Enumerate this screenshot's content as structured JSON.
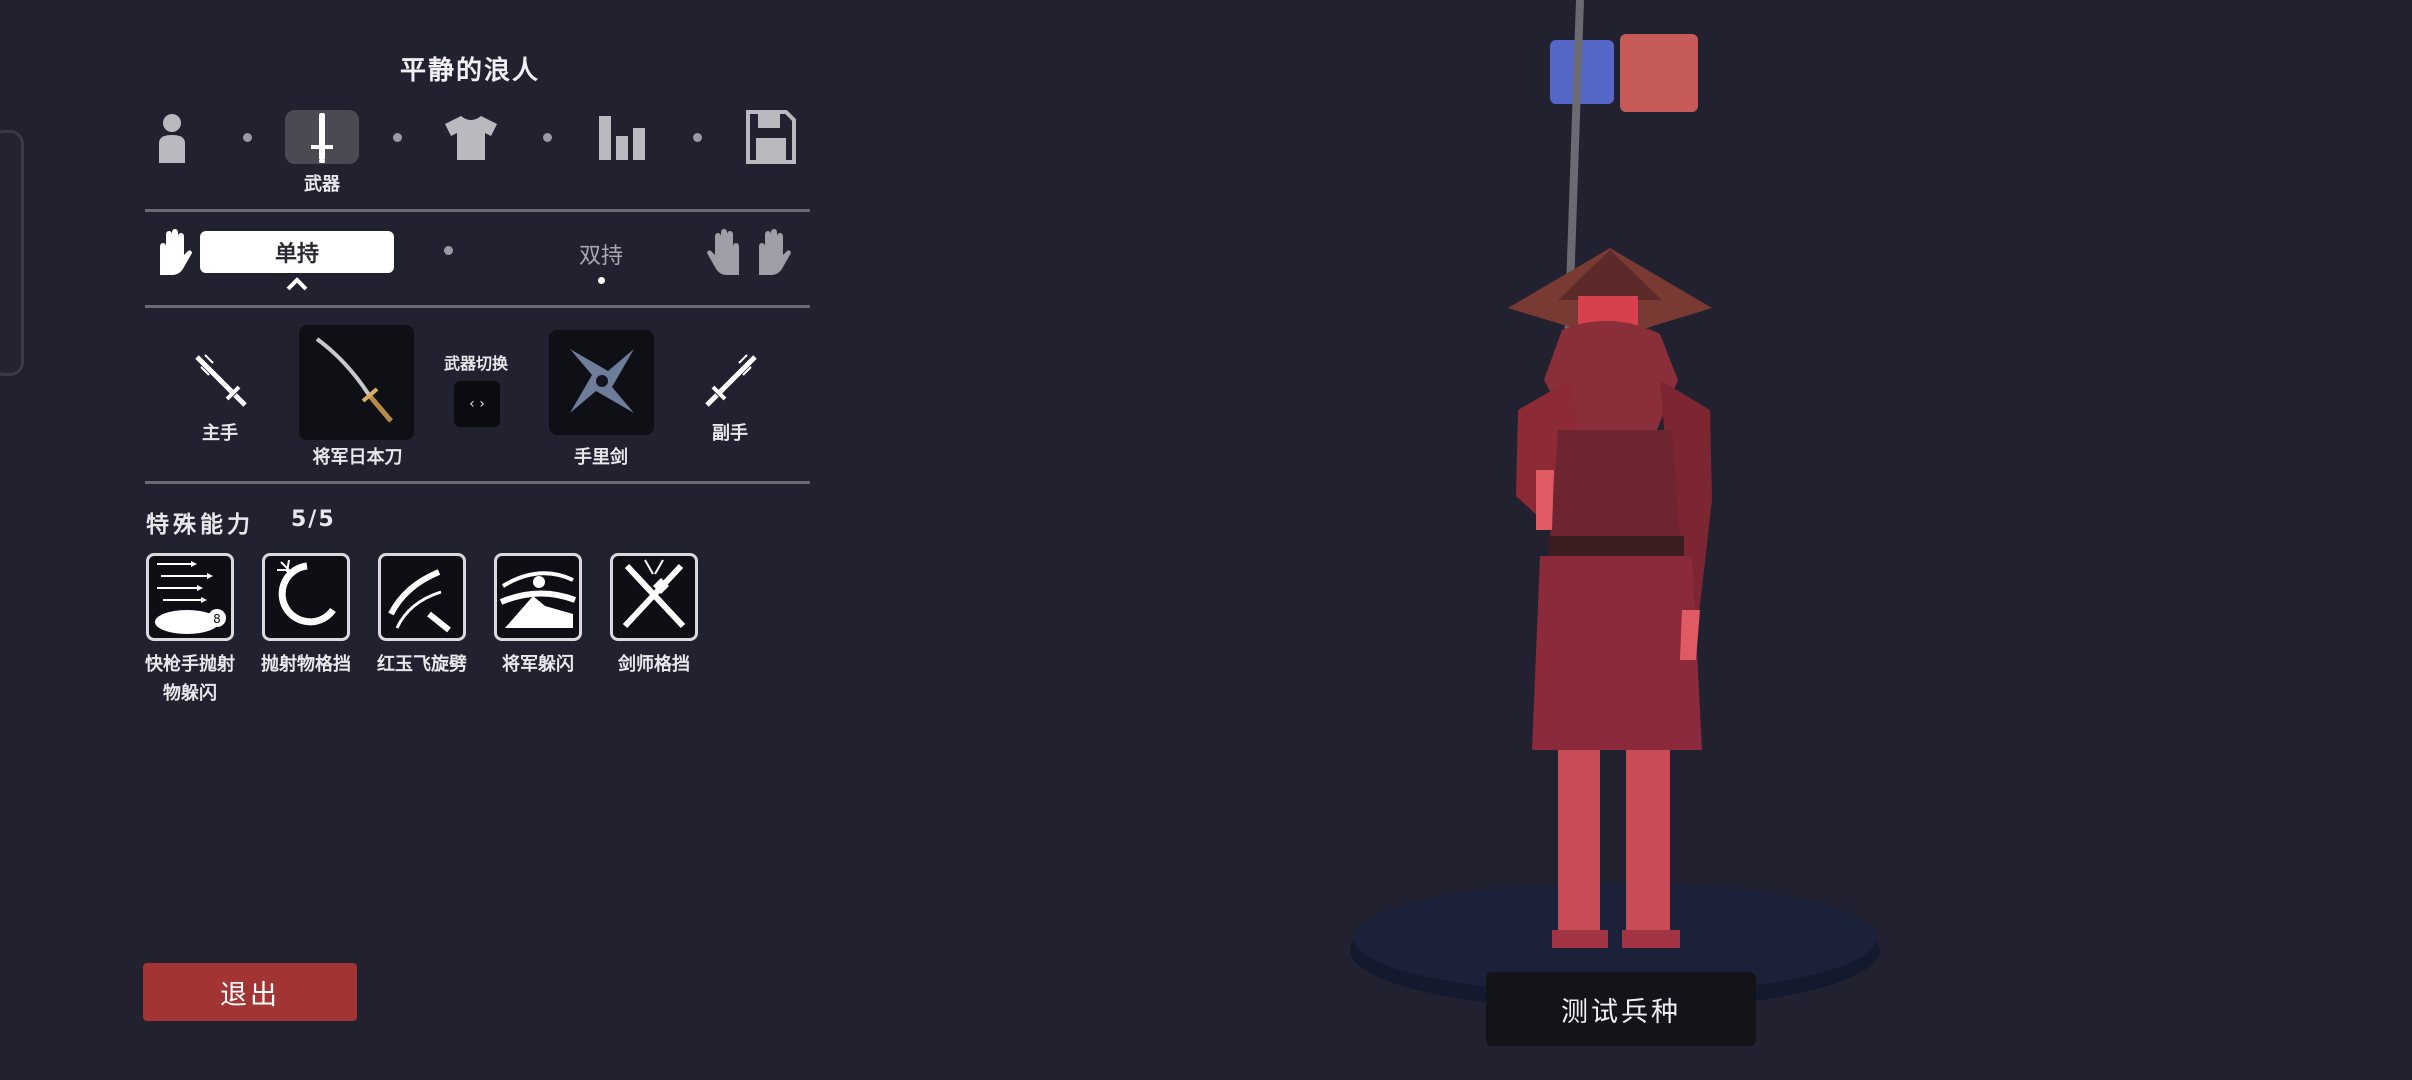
{
  "unit_name": "平静的浪人",
  "nav": {
    "tabs": [
      {
        "name": "person-icon"
      },
      {
        "name": "sword-icon",
        "label": "武器",
        "selected": true
      },
      {
        "name": "shirt-icon"
      },
      {
        "name": "stats-icon"
      },
      {
        "name": "save-icon"
      }
    ]
  },
  "grip": {
    "single_label": "单持",
    "dual_label": "双持"
  },
  "weapons": {
    "main_hand_label": "主手",
    "off_hand_label": "副手",
    "main_weapon_name": "将军日本刀",
    "off_weapon_name": "手里剑",
    "swap_label": "武器切换",
    "swap_icon": "‹ ›"
  },
  "abilities": {
    "title": "特殊能力",
    "count": "5/5",
    "items": [
      {
        "label_line1": "快枪手抛射",
        "label_line2": "物躲闪",
        "icon": "bullet-dodge-icon"
      },
      {
        "label_line1": "抛射物格挡",
        "label_line2": "",
        "icon": "projectile-block-icon"
      },
      {
        "label_line1": "红玉飞旋劈",
        "label_line2": "",
        "icon": "spin-slash-icon"
      },
      {
        "label_line1": "将军躲闪",
        "label_line2": "",
        "icon": "general-dodge-icon"
      },
      {
        "label_line1": "剑师格挡",
        "label_line2": "",
        "icon": "crossed-swords-icon"
      }
    ]
  },
  "exit_label": "退出",
  "test_label": "测试兵种",
  "team_colors": {
    "blue": "#5567c6",
    "red": "#c65a59"
  }
}
